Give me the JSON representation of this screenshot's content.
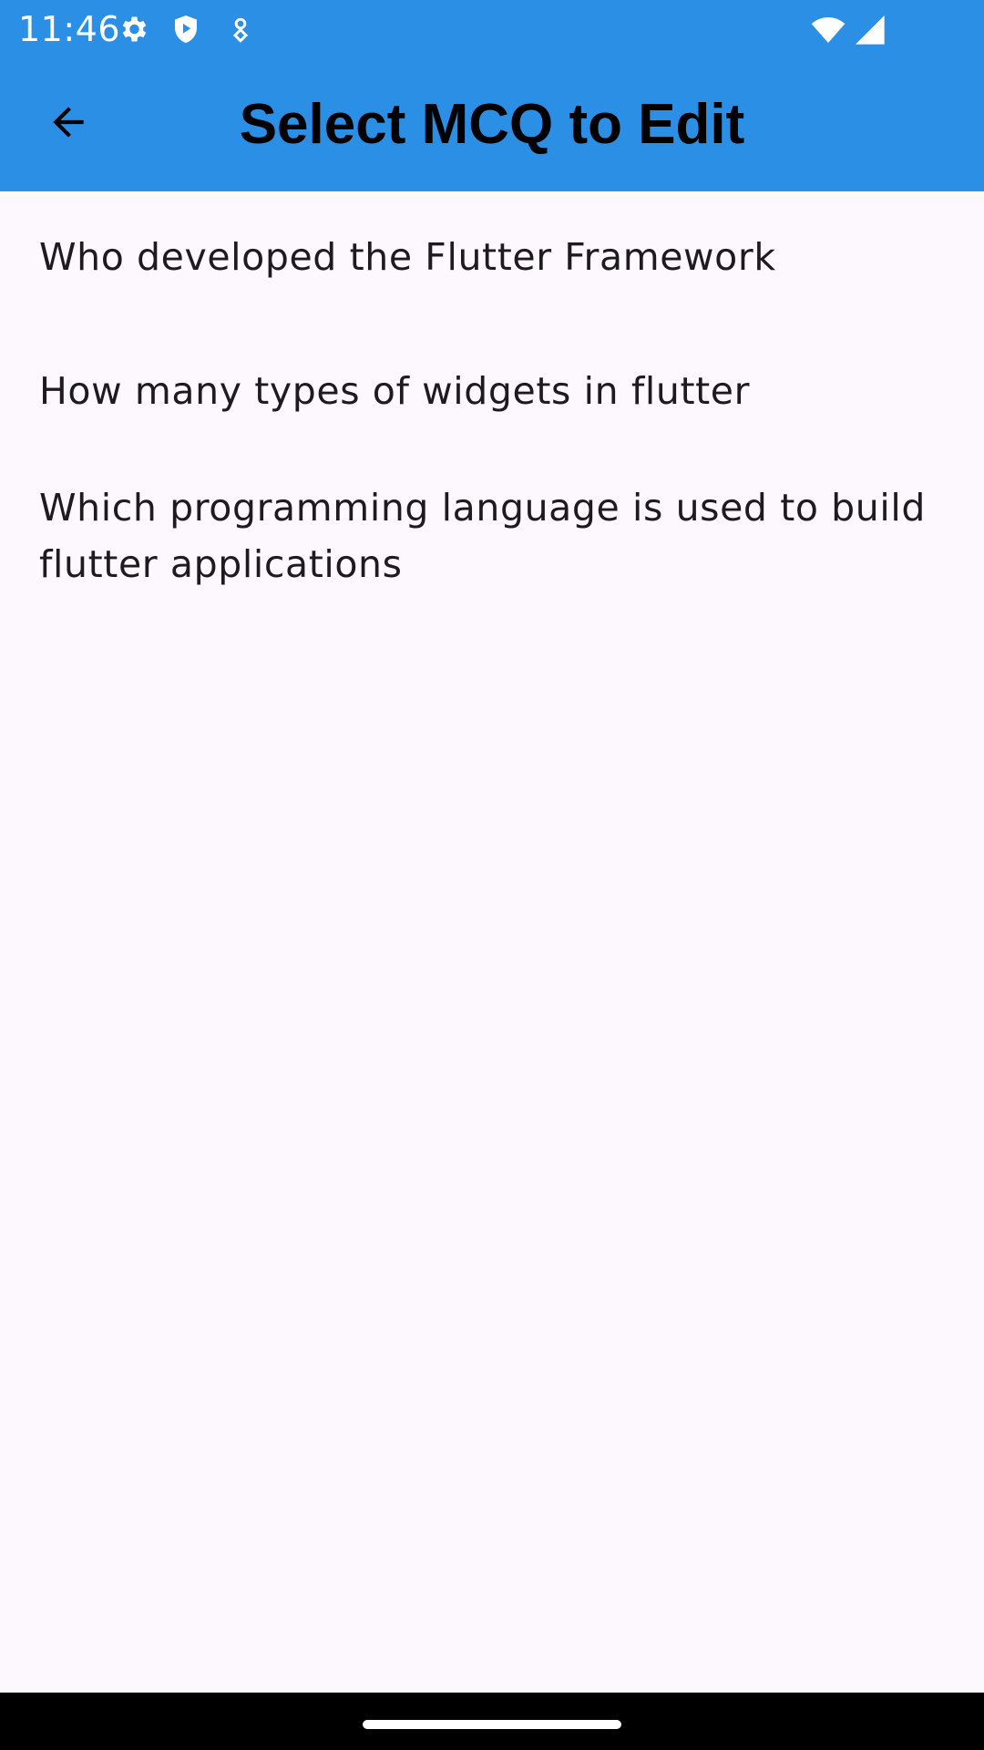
{
  "status_bar": {
    "time": "11:46",
    "icons": [
      "gear-icon",
      "shield-play-icon",
      "location-pin-icon",
      "wifi-icon",
      "signal-icon"
    ],
    "background": "#2b8fe6"
  },
  "app_bar": {
    "title": "Select MCQ to Edit",
    "back_icon": "arrow-back-icon",
    "background": "#2b8fe6"
  },
  "questions": [
    {
      "text": "Who developed the Flutter Framework"
    },
    {
      "text": "How many types of widgets in flutter"
    },
    {
      "text": "Which programming language is used to build flutter applications"
    }
  ],
  "colors": {
    "background": "#fdf7fe",
    "text": "#1d1b20"
  }
}
